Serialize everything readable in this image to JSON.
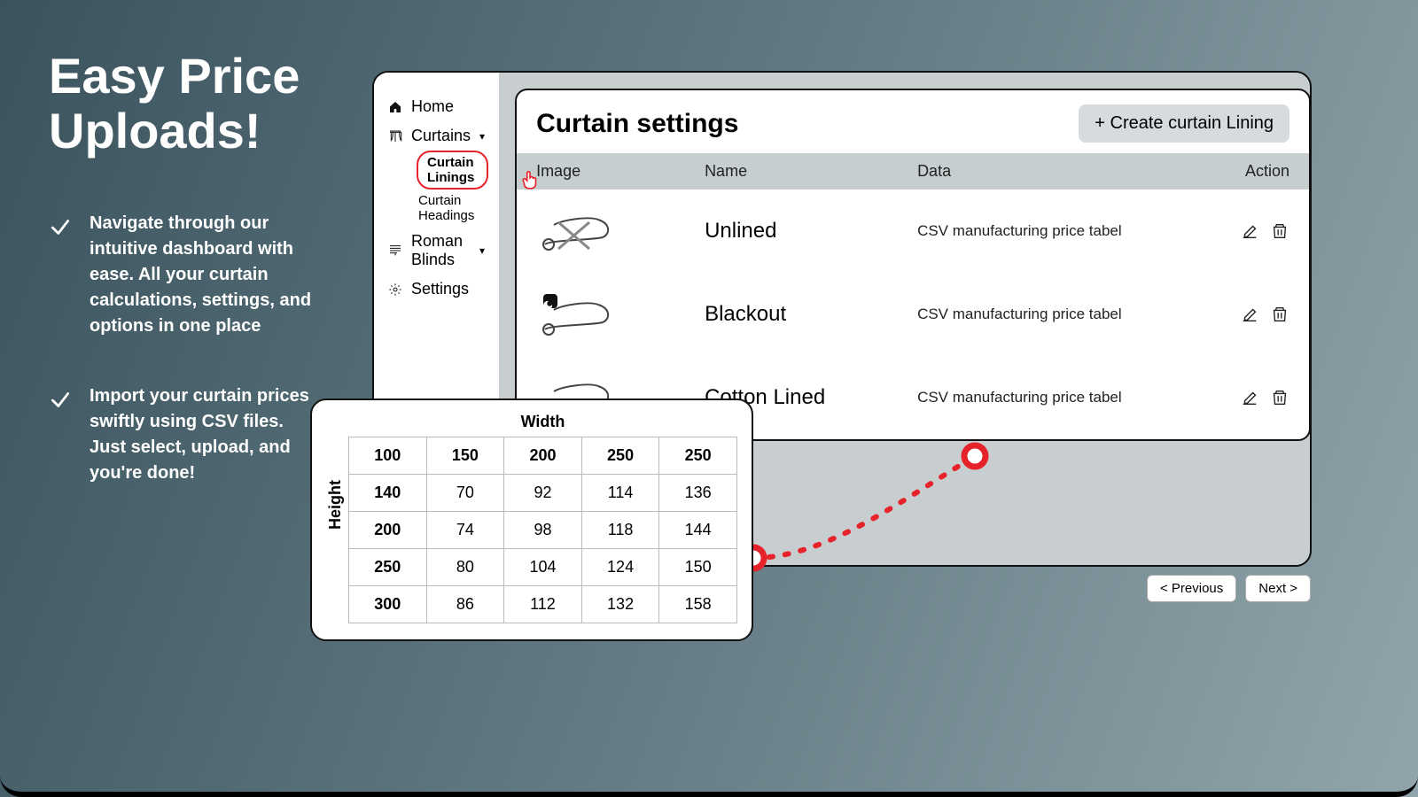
{
  "promo": {
    "headline": "Easy Price Uploads!",
    "bullets": [
      "Navigate through our intuitive dashboard with ease. All your curtain calculations, settings, and options in one place",
      "Import your curtain prices swiftly using CSV files. Just select, upload, and you're done!"
    ]
  },
  "sidebar": {
    "home": "Home",
    "curtains": "Curtains",
    "curtain_linings": "Curtain Linings",
    "curtain_headings": "Curtain Headings",
    "roman_blinds": "Roman Blinds",
    "settings": "Settings"
  },
  "panel": {
    "title": "Curtain settings",
    "create_btn": "+ Create curtain Lining",
    "columns": {
      "image": "Image",
      "name": "Name",
      "data": "Data",
      "action": "Action"
    },
    "rows": [
      {
        "name": "Unlined",
        "data": "CSV manufacturing price tabel"
      },
      {
        "name": "Blackout",
        "data": "CSV manufacturing price tabel"
      },
      {
        "name": "Cotton Lined",
        "data": "CSV manufacturing price tabel"
      }
    ],
    "pager": {
      "prev": "< Previous",
      "next": "Next >"
    }
  },
  "chart_data": {
    "type": "table",
    "xlabel": "Width",
    "ylabel": "Height",
    "col_headers": [
      "100",
      "150",
      "200",
      "250",
      "250"
    ],
    "rows": [
      {
        "label": "140",
        "values": [
          "70",
          "92",
          "114",
          "136"
        ]
      },
      {
        "label": "200",
        "values": [
          "74",
          "98",
          "118",
          "144"
        ]
      },
      {
        "label": "250",
        "values": [
          "80",
          "104",
          "124",
          "150"
        ]
      },
      {
        "label": "300",
        "values": [
          "86",
          "112",
          "132",
          "158"
        ]
      }
    ]
  }
}
